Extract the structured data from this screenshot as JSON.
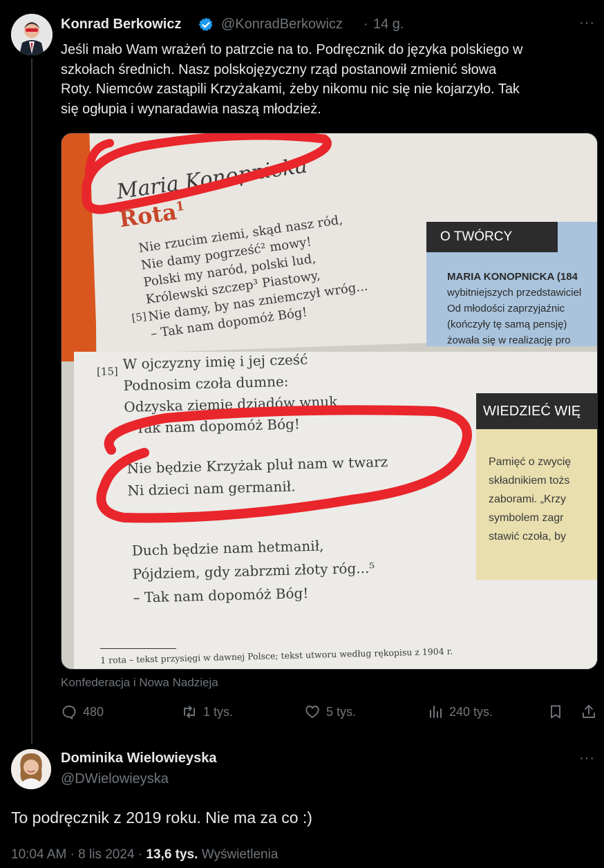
{
  "tweet": {
    "author_name": "Konrad Berkowicz",
    "author_handle": "@KonradBerkowicz",
    "separator": "·",
    "time_ago": "14 g.",
    "text": "Jeśli mało Wam wrażeń to patrzcie na to. Podręcznik do języka polskiego w\nszkołach średnich. Nasz polskojęzyczny rząd postanowił zmienić słowa\nRoty. Niemców zastąpili Krzyżakami, żeby nikomu nic się nie kojarzyło. Tak\nsię ogłupia i wynaradawia naszą młodzież.",
    "more": "···",
    "affiliation": "Konfederacja i Nowa Nadzieja",
    "replies": "480",
    "reposts": "1 tys.",
    "likes": "5 tys.",
    "views": "240 tys.",
    "photo": {
      "author": "Maria Konopnicka",
      "title": "Rota",
      "title_mark": "1",
      "lines_top": [
        "Nie rzucim ziemi, skąd nasz ród,",
        "Nie damy pogrześć² mowy!",
        "Polski my naród, polski lud,",
        "Królewski szczep³ Piastowy,",
        "Nie damy, by nas zniemczył wróg...",
        "– Tak nam dopomóż Bóg!"
      ],
      "line_num_5": "[5]",
      "line_num_15": "[15]",
      "lines_mid": [
        "W ojczyzny imię i jej cześć",
        "Podnosim czoła dumne:",
        "Odzyska ziemię dziadów wnuk",
        "– Tak nam dopomóż Bóg!"
      ],
      "lines_highlight": [
        "Nie będzie Krzyżak pluł nam w twarz",
        "Ni dzieci nam germanił."
      ],
      "lines_bottom": [
        "Duch będzie nam hetmanił,",
        "Pójdziem, gdy zabrzmi złoty róg...⁵",
        "– Tak nam dopomóż Bóg!"
      ],
      "footnote": "1 rota – tekst przysięgi w dawnej Polsce; tekst utworu według rękopisu z 1904 r.",
      "box1_header": "O TWÓRCY",
      "box1_lines": [
        "MARIA KONOPNICKA (184",
        "wybitniejszych przedstawiciel",
        "Od młodości zaprzyjaźnic",
        "(kończyły tę samą pensję)",
        "żowała się w realizację pro"
      ],
      "box2_header": "WIEDZIEĆ WIĘ",
      "box2_lines": [
        "Pamięć o zwycię",
        "składnikiem tożs",
        "zaborami. „Krzy",
        "symbolem zagr",
        "stawić czoła, by"
      ]
    }
  },
  "reply": {
    "author_name": "Dominika Wielowieyska",
    "author_handle": "@DWielowieyska",
    "more": "···",
    "text": "To podręcznik z 2019 roku. Nie ma za co :)",
    "time": "10:04 AM",
    "date": "8 lis 2024",
    "views_count": "13,6 tys.",
    "views_label": "Wyświetlenia",
    "separator": "·"
  },
  "colors": {
    "background": "#000000",
    "text": "#e7e9ea",
    "muted": "#71767b",
    "verified": "#1d9bf0",
    "highlight_marker": "#e8262b"
  }
}
